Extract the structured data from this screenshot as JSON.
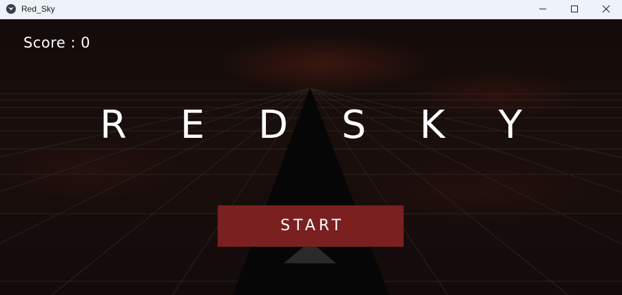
{
  "window": {
    "title": "Red_Sky",
    "app_icon": "app-icon",
    "controls": [
      "minimize-icon",
      "maximize-icon",
      "close-icon"
    ]
  },
  "game": {
    "score_label": "Score : 0",
    "title": "R E D   S K Y",
    "start_label": "START",
    "colors": {
      "background": "#140c0a",
      "grid_line": "#2a2220",
      "ship": "#060606",
      "start_button": "#7b2020",
      "text": "#ffffff"
    }
  }
}
